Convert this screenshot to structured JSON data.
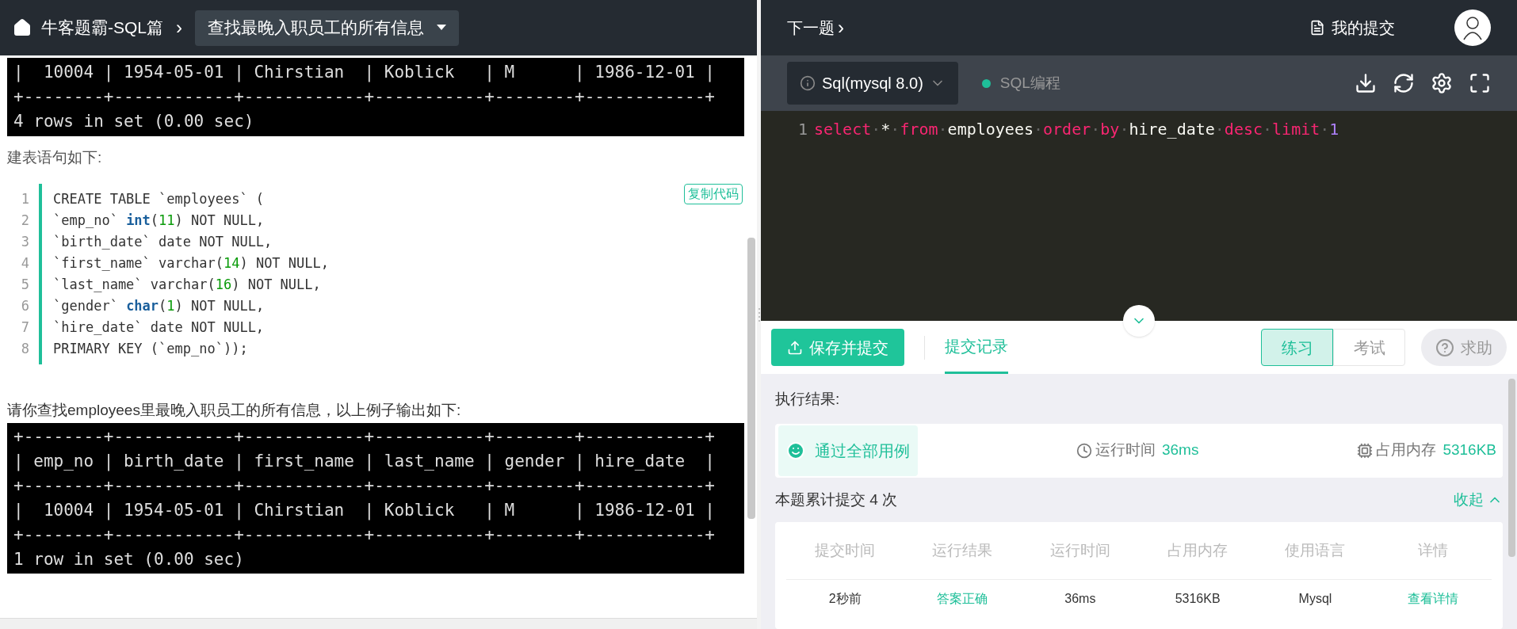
{
  "left_header": {
    "breadcrumb": "牛客题霸-SQL篇",
    "separator": "›",
    "problem_select": "查找最晚入职员工的所有信息"
  },
  "content": {
    "top_output": [
      "|  10004 | 1954-05-01 | Chirstian  | Koblick   | M      | 1986-12-01 |",
      "+--------+------------+------------+-----------+--------+------------+",
      "4 rows in set (0.00 sec)"
    ],
    "schema_intro": "建表语句如下:",
    "copy_button": "复制代码",
    "code_lines": [
      [
        {
          "kind": "plain",
          "text": "CREATE TABLE `employees` ("
        }
      ],
      [
        {
          "kind": "plain",
          "text": "`emp_no` "
        },
        {
          "kind": "type",
          "text": "int"
        },
        {
          "kind": "plain",
          "text": "("
        },
        {
          "kind": "number",
          "text": "11"
        },
        {
          "kind": "plain",
          "text": ") NOT NULL,"
        }
      ],
      [
        {
          "kind": "plain",
          "text": "`birth_date` date NOT NULL,"
        }
      ],
      [
        {
          "kind": "plain",
          "text": "`first_name` varchar("
        },
        {
          "kind": "number",
          "text": "14"
        },
        {
          "kind": "plain",
          "text": ") NOT NULL,"
        }
      ],
      [
        {
          "kind": "plain",
          "text": "`last_name` varchar("
        },
        {
          "kind": "number",
          "text": "16"
        },
        {
          "kind": "plain",
          "text": ") NOT NULL,"
        }
      ],
      [
        {
          "kind": "plain",
          "text": "`gender` "
        },
        {
          "kind": "type",
          "text": "char"
        },
        {
          "kind": "plain",
          "text": "("
        },
        {
          "kind": "number",
          "text": "1"
        },
        {
          "kind": "plain",
          "text": ") NOT NULL,"
        }
      ],
      [
        {
          "kind": "plain",
          "text": "`hire_date` date NOT NULL,"
        }
      ],
      [
        {
          "kind": "plain",
          "text": "PRIMARY KEY (`emp_no`));"
        }
      ]
    ],
    "line_numbers": [
      "1",
      "2",
      "3",
      "4",
      "5",
      "6",
      "7",
      "8"
    ],
    "question": "请你查找employees里最晚入职员工的所有信息，以上例子输出如下:",
    "example_output": [
      "+--------+------------+------------+-----------+--------+------------+",
      "| emp_no | birth_date | first_name | last_name | gender | hire_date  |",
      "+--------+------------+------------+-----------+--------+------------+",
      "|  10004 | 1954-05-01 | Chirstian  | Koblick   | M      | 1986-12-01 |",
      "+--------+------------+------------+-----------+--------+------------+",
      "1 row in set (0.00 sec)"
    ]
  },
  "right_header": {
    "next": "下一题",
    "next_arrow": "›",
    "my_submissions": "我的提交"
  },
  "toolbar": {
    "language": "Sql(mysql 8.0)",
    "mode": "SQL编程"
  },
  "editor": {
    "line_number": "1",
    "tokens": [
      {
        "kind": "keyword",
        "text": "select"
      },
      {
        "kind": "ws",
        "text": "·"
      },
      {
        "kind": "plain",
        "text": "*"
      },
      {
        "kind": "ws",
        "text": "·"
      },
      {
        "kind": "keyword",
        "text": "from"
      },
      {
        "kind": "ws",
        "text": "·"
      },
      {
        "kind": "plain",
        "text": "employees"
      },
      {
        "kind": "ws",
        "text": "·"
      },
      {
        "kind": "keyword",
        "text": "order"
      },
      {
        "kind": "ws",
        "text": "·"
      },
      {
        "kind": "keyword",
        "text": "by"
      },
      {
        "kind": "ws",
        "text": "·"
      },
      {
        "kind": "plain",
        "text": "hire_date"
      },
      {
        "kind": "ws",
        "text": "·"
      },
      {
        "kind": "keyword",
        "text": "desc"
      },
      {
        "kind": "ws",
        "text": "·"
      },
      {
        "kind": "keyword",
        "text": "limit"
      },
      {
        "kind": "ws",
        "text": "·"
      },
      {
        "kind": "number",
        "text": "1"
      }
    ]
  },
  "actions": {
    "submit": "保存并提交",
    "tabs": [
      {
        "label": "提交记录",
        "selected": true
      }
    ],
    "modes": [
      {
        "label": "练习",
        "selected": true
      },
      {
        "label": "考试",
        "selected": false
      }
    ],
    "help": "求助"
  },
  "result": {
    "title": "执行结果:",
    "status": "通过全部用例",
    "time_label": "运行时间",
    "time": "36ms",
    "memory_label": "占用内存",
    "memory": "5316KB"
  },
  "history": {
    "summary": "本题累计提交 4 次",
    "collapse": "收起",
    "columns": [
      "提交时间",
      "运行结果",
      "运行时间",
      "占用内存",
      "使用语言",
      "详情"
    ],
    "rows": [
      {
        "cells": [
          "2秒前",
          "答案正确",
          "36ms",
          "5316KB",
          "Mysql",
          "查看详情"
        ]
      }
    ]
  }
}
